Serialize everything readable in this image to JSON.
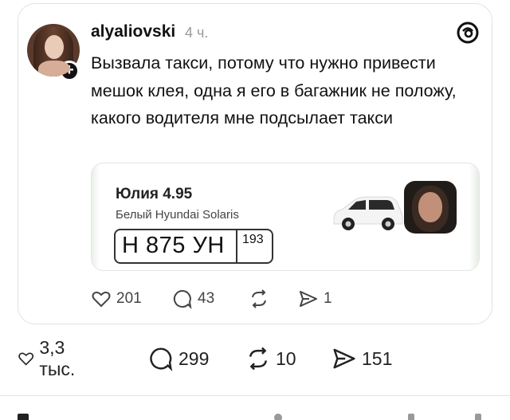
{
  "post": {
    "username": "alyaliovski",
    "time": "4 ч.",
    "text": "Вызвала такси, потому что нужно привести мешок клея, одна я его в багажник не положу, какого водителя мне подсылает такси",
    "avatar_icon": "user-avatar",
    "follow_icon": "plus-icon",
    "brand_icon": "threads-logo-icon"
  },
  "taxi": {
    "driver": "Юлия 4.95",
    "car": "Белый Hyundai Solaris",
    "plate_number": "Н 875 УН",
    "plate_region": "193"
  },
  "inner_actions": {
    "likes": "201",
    "comments": "43",
    "reposts": "",
    "shares": "1"
  },
  "outer_actions": {
    "likes": "3,3 тыс.",
    "comments": "299",
    "reposts": "10",
    "shares": "151"
  }
}
